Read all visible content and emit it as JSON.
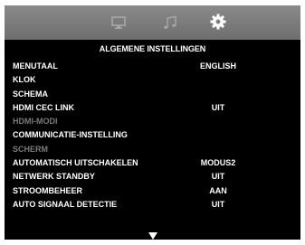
{
  "tabs": [
    {
      "icon": "monitor-icon"
    },
    {
      "icon": "music-note-icon"
    },
    {
      "icon": "gear-icon"
    }
  ],
  "menu": {
    "title": "ALGEMENE INSTELLINGEN",
    "items": [
      {
        "label": "MENUTAAL",
        "value": "ENGLISH"
      },
      {
        "label": "KLOK",
        "value": ""
      },
      {
        "label": "SCHEMA",
        "value": ""
      },
      {
        "label": "HDMI CEC LINK",
        "value": "UIT"
      },
      {
        "label": "HDMI-MODI",
        "value": ""
      },
      {
        "label": "COMMUNICATIE-INSTELLING",
        "value": ""
      },
      {
        "label": "SCHERM",
        "value": ""
      },
      {
        "label": "AUTOMATISCH UITSCHAKELEN",
        "value": "MODUS2"
      },
      {
        "label": "NETWERK STANDBY",
        "value": "UIT"
      },
      {
        "label": "STROOMBEHEER",
        "value": "AAN"
      },
      {
        "label": "AUTO SIGNAAL DETECTIE",
        "value": "UIT"
      }
    ]
  },
  "colors": {
    "disabled_text": "#7a7a7a",
    "topbar": "#7d7d7d"
  }
}
